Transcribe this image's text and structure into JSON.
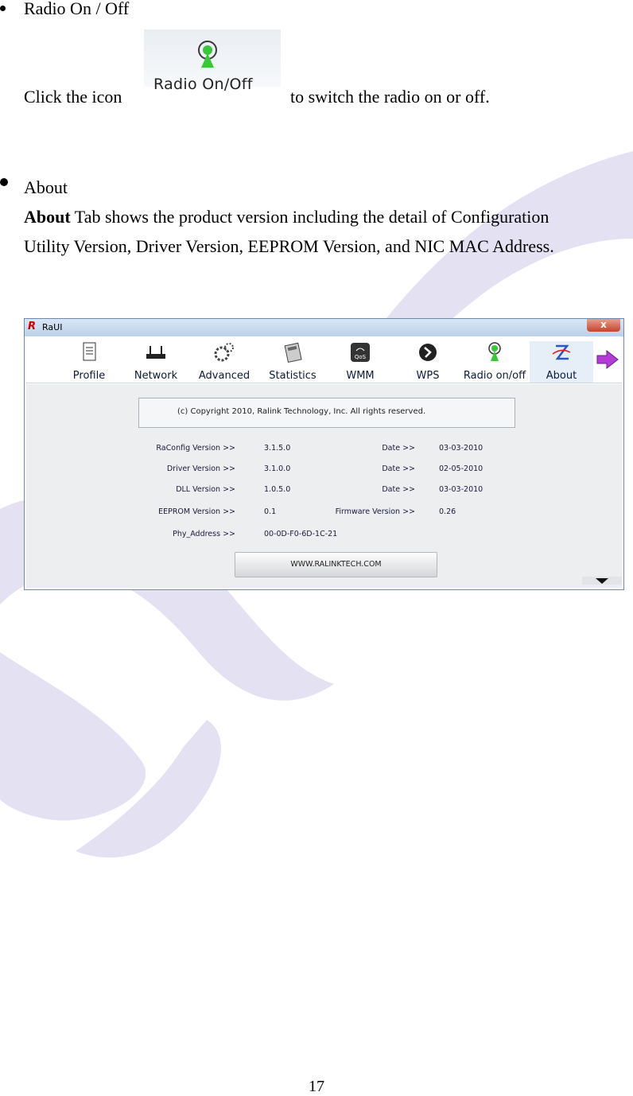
{
  "radio_section": {
    "heading": "Radio On / Off",
    "text_before": "Click the icon",
    "icon_label": "Radio On/Off",
    "text_after": "to switch the radio on or off."
  },
  "about_section": {
    "heading": "About",
    "bold_word": "About",
    "line1_rest": " Tab shows the product version including the detail of Configuration",
    "line2": "Utility Version, Driver Version, EEPROM Version, and NIC MAC Address."
  },
  "window": {
    "logo": "R",
    "title": "RaUI",
    "close": "x",
    "toolbar": [
      {
        "label": "Profile",
        "icon": "profile-icon"
      },
      {
        "label": "Network",
        "icon": "network-icon"
      },
      {
        "label": "Advanced",
        "icon": "advanced-icon"
      },
      {
        "label": "Statistics",
        "icon": "statistics-icon"
      },
      {
        "label": "WMM",
        "icon": "wmm-icon",
        "badge": "QoS"
      },
      {
        "label": "WPS",
        "icon": "wps-icon"
      },
      {
        "label": "Radio on/off",
        "icon": "radio-icon"
      },
      {
        "label": "About",
        "icon": "about-icon"
      }
    ],
    "copyright": "(c) Copyright 2010, Ralink Technology, Inc.  All rights reserved.",
    "rows": [
      {
        "label": "RaConfig Version >>",
        "value": "3.1.5.0",
        "label2": "Date >>",
        "value2": "03-03-2010"
      },
      {
        "label": "Driver Version >>",
        "value": "3.1.0.0",
        "label2": "Date >>",
        "value2": "02-05-2010"
      },
      {
        "label": "DLL Version >>",
        "value": "1.0.5.0",
        "label2": "Date >>",
        "value2": "03-03-2010"
      },
      {
        "label": "EEPROM Version >>",
        "value": "0.1",
        "label2": "Firmware Version >>",
        "value2": "0.26"
      },
      {
        "label": "Phy_Address >>",
        "value": "00-0D-F0-6D-1C-21"
      }
    ],
    "url_button": "WWW.RALINKTECH.COM"
  },
  "colors": {
    "watermark": "#e4e1f2",
    "accent_purple": "#b23bd6",
    "radio_green": "#37c837"
  },
  "page_number": "17"
}
